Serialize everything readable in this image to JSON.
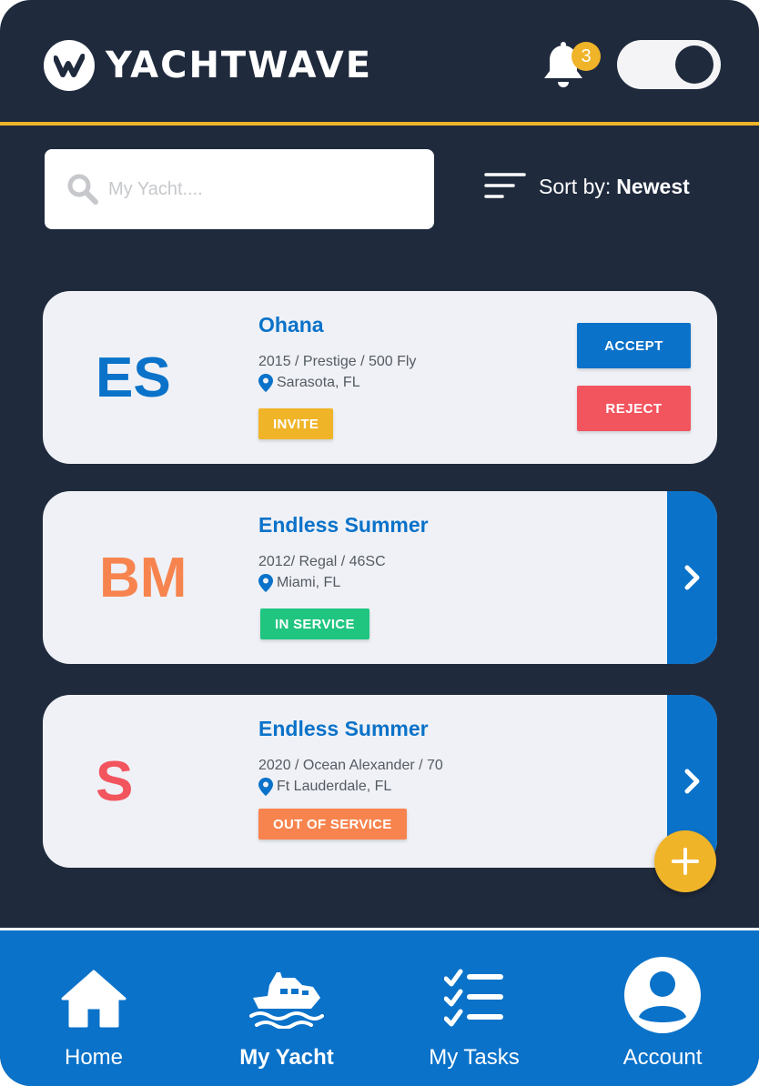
{
  "app": {
    "brand": "YACHTWAVE",
    "notification_count": "3"
  },
  "search": {
    "placeholder": "My Yacht...."
  },
  "sort": {
    "label": "Sort by:",
    "value": "Newest"
  },
  "yachts": [
    {
      "initials": "ES",
      "initials_color": "#0a72c9",
      "name": "Ohana",
      "details": "2015 / Prestige / 500 Fly",
      "location": "Sarasota, FL",
      "status": "INVITE",
      "status_color": "#f0b429",
      "accept_label": "ACCEPT",
      "reject_label": "REJECT"
    },
    {
      "initials": "BM",
      "initials_color": "#f7844e",
      "name": "Endless Summer",
      "details": "2012/ Regal / 46SC",
      "location": "Miami, FL",
      "status": "IN SERVICE",
      "status_color": "#20c580"
    },
    {
      "initials": "S",
      "initials_color": "#f2555e",
      "name": "Endless Summer",
      "details": "2020 / Ocean Alexander / 70",
      "location": "Ft Lauderdale, FL",
      "status": "OUT OF SERVICE",
      "status_color": "#f7844e"
    }
  ],
  "nav": [
    {
      "label": "Home",
      "icon": "home-icon"
    },
    {
      "label": "My Yacht",
      "icon": "yacht-icon",
      "active": true
    },
    {
      "label": "My Tasks",
      "icon": "tasks-icon"
    },
    {
      "label": "Account",
      "icon": "account-icon"
    }
  ],
  "colors": {
    "primary": "#0a72c9",
    "accent": "#f0b429",
    "background": "#1f2a3d",
    "card": "#eff1f6",
    "reject": "#f2555e"
  }
}
